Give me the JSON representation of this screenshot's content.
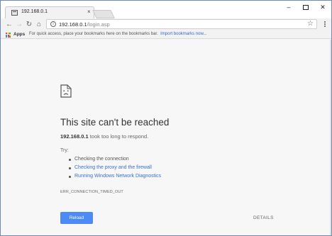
{
  "tab": {
    "title": "192.168.0.1",
    "close_glyph": "×"
  },
  "window_controls": {
    "minimize": "–",
    "close": "✕"
  },
  "toolbar": {
    "back_glyph": "←",
    "forward_glyph": "→",
    "reload_glyph": "↻",
    "home_glyph": "⌂",
    "url_host": "192.168.0.1",
    "url_path": "/login.asp",
    "info_glyph": "i",
    "star_glyph": "☆"
  },
  "bookmarks_bar": {
    "apps_label": "Apps",
    "hint": "For quick access, place your bookmarks here on the bookmarks bar.",
    "import_link": "Import bookmarks now..."
  },
  "error_page": {
    "headline": "This site can't be reached",
    "host": "192.168.0.1",
    "message": " took too long to respond.",
    "try_label": "Try:",
    "suggestions": [
      "Checking the connection",
      "Checking the proxy and the firewall",
      "Running Windows Network Diagnostics"
    ],
    "error_code": "ERR_CONNECTION_TIMED_OUT",
    "reload_label": "Reload",
    "details_label": "DETAILS"
  },
  "colors": {
    "accent_blue": "#4c8bf5",
    "link_blue": "#3b6fd1",
    "apps_icon": [
      "#ea4335",
      "#fbbc05",
      "#34a853",
      "#4285f4",
      "#ea4335",
      "#fbbc05",
      "#34a853",
      "#4285f4",
      "#ea4335"
    ]
  }
}
